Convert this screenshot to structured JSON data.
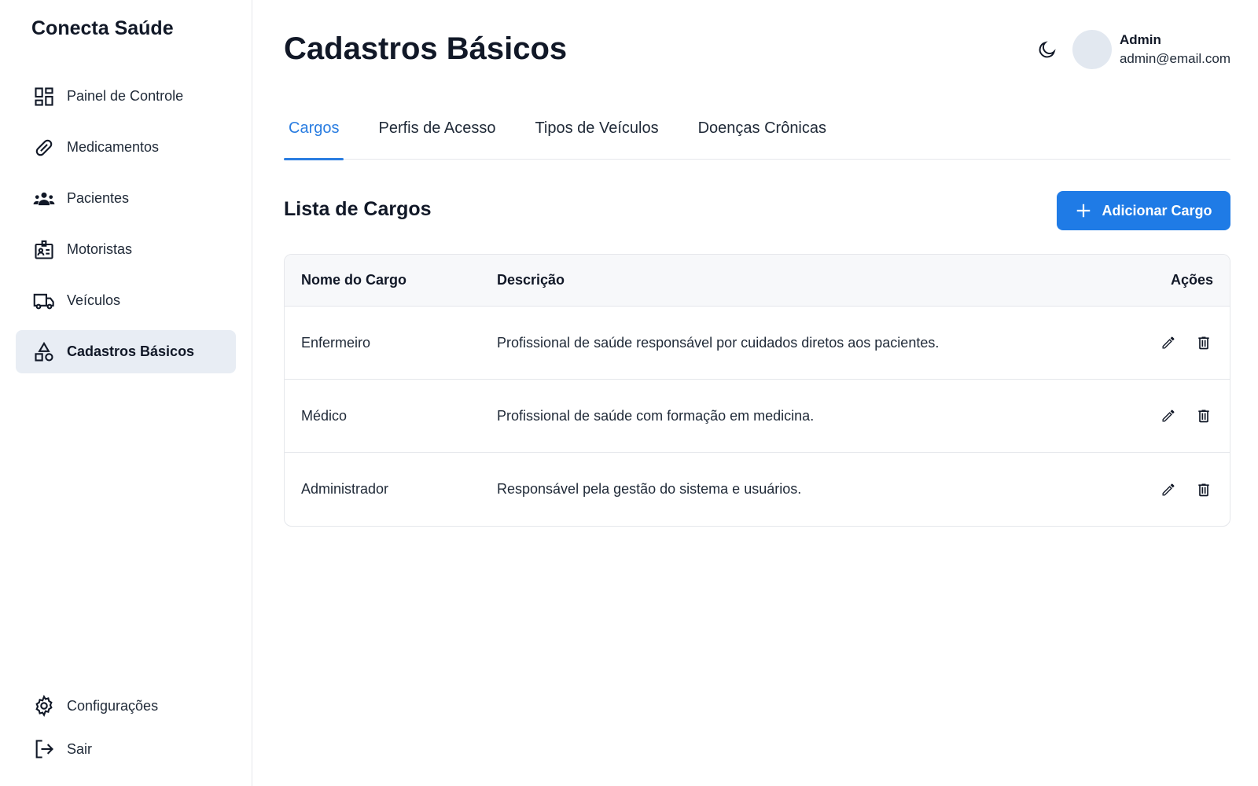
{
  "app": {
    "brand": "Conecta Saúde"
  },
  "sidebar": {
    "items": [
      {
        "label": "Painel de Controle",
        "icon": "dashboard-icon"
      },
      {
        "label": "Medicamentos",
        "icon": "pill-icon"
      },
      {
        "label": "Pacientes",
        "icon": "people-icon"
      },
      {
        "label": "Motoristas",
        "icon": "id-badge-icon"
      },
      {
        "label": "Veículos",
        "icon": "truck-icon"
      },
      {
        "label": "Cadastros Básicos",
        "icon": "shapes-icon",
        "active": true
      }
    ],
    "bottom_items": [
      {
        "label": "Configurações",
        "icon": "gear-icon"
      },
      {
        "label": "Sair",
        "icon": "logout-icon"
      }
    ]
  },
  "header": {
    "title": "Cadastros Básicos",
    "user": {
      "name": "Admin",
      "email": "admin@email.com"
    }
  },
  "tabs": [
    {
      "label": "Cargos",
      "active": true
    },
    {
      "label": "Perfis de Acesso"
    },
    {
      "label": "Tipos de Veículos"
    },
    {
      "label": "Doenças Crônicas"
    }
  ],
  "section": {
    "title": "Lista de Cargos",
    "add_button_label": "Adicionar Cargo"
  },
  "table": {
    "columns": {
      "name": "Nome do Cargo",
      "description": "Descrição",
      "actions": "Ações"
    },
    "rows": [
      {
        "name": "Enfermeiro",
        "description": "Profissional de saúde responsável por cuidados diretos aos pacientes."
      },
      {
        "name": "Médico",
        "description": "Profissional de saúde com formação em medicina."
      },
      {
        "name": "Administrador",
        "description": "Responsável pela gestão do sistema e usuários."
      }
    ]
  },
  "colors": {
    "accent": "#1f7be6",
    "active_nav_bg": "#e8edf4",
    "header_bg": "#f7f8fa"
  }
}
